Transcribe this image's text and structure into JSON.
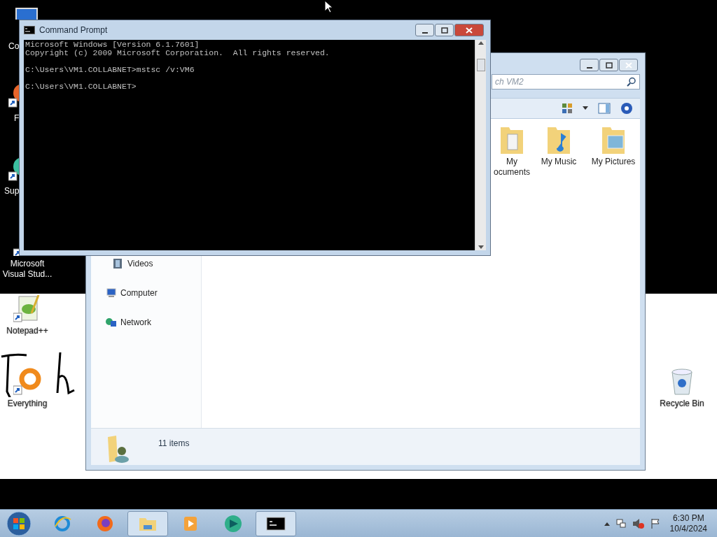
{
  "desktop_icons": [
    {
      "kind": "computer",
      "label": "Co"
    },
    {
      "kind": "shortcut-orange",
      "label": "F"
    },
    {
      "kind": "shortcut-teal",
      "label": "Sup"
    },
    {
      "kind": "shortcut-gray",
      "label": "Microsoft Visual Stud..."
    },
    {
      "kind": "notepad",
      "label": "Notepad++"
    },
    {
      "kind": "everything",
      "label": "Everything"
    },
    {
      "kind": "recycle",
      "label": "Recycle Bin"
    }
  ],
  "explorer": {
    "search_placeholder": "ch VM2",
    "items": [
      {
        "kind": "documents",
        "lines": [
          "My",
          "ocuments"
        ]
      },
      {
        "kind": "music",
        "lines": [
          "My Music"
        ]
      },
      {
        "kind": "pictures",
        "lines": [
          "My Pictures"
        ]
      }
    ],
    "nav": [
      {
        "kind": "videos",
        "label": "Videos"
      },
      {
        "kind": "computer",
        "label": "Computer"
      },
      {
        "kind": "network",
        "label": "Network"
      }
    ],
    "status": "11 items"
  },
  "cmd": {
    "title": "Command Prompt",
    "blocks": [
      [
        "Microsoft Windows [Version 6.1.7601]",
        "Copyright (c) 2009 Microsoft Corporation.  All rights reserved."
      ],
      [
        "C:\\Users\\VM1.COLLABNET>mstsc /v:VM6"
      ],
      [
        "C:\\Users\\VM1.COLLABNET>"
      ]
    ]
  },
  "taskbar": {
    "apps": [
      {
        "kind": "ie",
        "running": false
      },
      {
        "kind": "firefox",
        "running": false
      },
      {
        "kind": "explorer",
        "running": true
      },
      {
        "kind": "media",
        "running": false
      },
      {
        "kind": "green",
        "running": false
      },
      {
        "kind": "cmd",
        "running": true
      }
    ],
    "time": "6:30 PM",
    "date": "10/4/2024"
  }
}
